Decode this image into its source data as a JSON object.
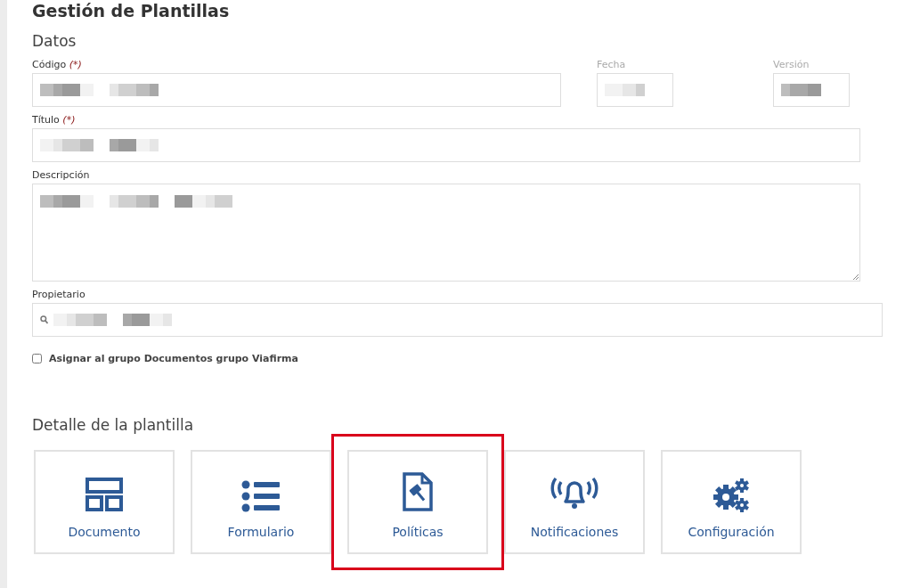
{
  "page": {
    "title": "Gestión de Plantillas"
  },
  "datos": {
    "heading": "Datos",
    "rows": [
      [
        {
          "kind": "text",
          "label": "Código",
          "required_mark": "(*)",
          "disabled": false,
          "redacted": true
        },
        {
          "kind": "text",
          "label": "Fecha",
          "disabled": true,
          "redacted": true
        },
        {
          "kind": "text",
          "label": "Versión",
          "disabled": true,
          "redacted": true
        }
      ],
      [
        {
          "kind": "text",
          "label": "Título",
          "required_mark": "(*)",
          "disabled": false,
          "redacted": true
        }
      ],
      [
        {
          "kind": "textarea",
          "label": "Descripción",
          "disabled": false,
          "redacted": true
        }
      ],
      [
        {
          "kind": "search",
          "label": "Propietario",
          "disabled": false,
          "redacted": true
        }
      ]
    ],
    "checkbox": {
      "label": "Asignar al grupo Documentos grupo Viafirma",
      "checked": false
    }
  },
  "detalle": {
    "heading": "Detalle de la plantilla",
    "cards": [
      {
        "label": "Documento",
        "highlighted": false
      },
      {
        "label": "Formulario",
        "highlighted": false
      },
      {
        "label": "Políticas",
        "highlighted": true
      },
      {
        "label": "Notificaciones",
        "highlighted": false
      },
      {
        "label": "Configuración",
        "highlighted": false
      }
    ]
  }
}
